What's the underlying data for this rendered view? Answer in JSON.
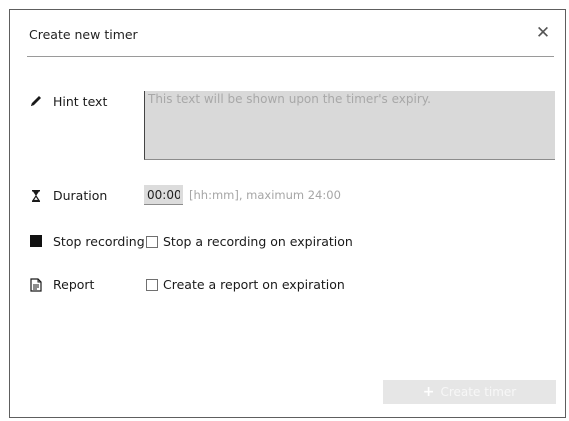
{
  "dialog": {
    "title": "Create new timer",
    "close_icon": "close-icon"
  },
  "hint": {
    "label": "Hint text",
    "icon": "pencil-icon",
    "placeholder": "This text will be shown upon the timer's expiry.",
    "value": ""
  },
  "duration": {
    "label": "Duration",
    "icon": "hourglass-icon",
    "value": "00:00",
    "hint": "[hh:mm], maximum 24:00"
  },
  "stop_recording": {
    "label": "Stop recording",
    "icon": "stop-square-icon",
    "checkbox_label": "Stop a recording on expiration",
    "checked": false
  },
  "report": {
    "label": "Report",
    "icon": "document-icon",
    "checkbox_label": "Create a report on expiration",
    "checked": false
  },
  "footer": {
    "create_button_label": "Create timer",
    "create_button_icon": "plus-icon",
    "create_button_enabled": false
  }
}
